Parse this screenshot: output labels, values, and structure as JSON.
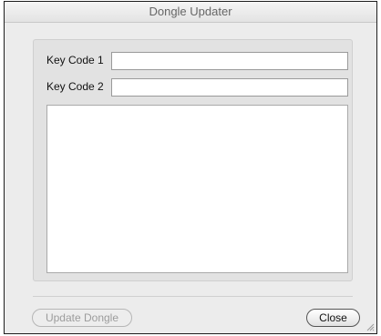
{
  "window": {
    "title": "Dongle Updater"
  },
  "form": {
    "key_code_1_label": "Key Code 1",
    "key_code_1_value": "",
    "key_code_2_label": "Key Code 2",
    "key_code_2_value": "",
    "output_text": ""
  },
  "buttons": {
    "update_label": "Update Dongle",
    "update_enabled": false,
    "close_label": "Close"
  },
  "icons": {
    "resize_grip": "resize-grip-icon"
  }
}
